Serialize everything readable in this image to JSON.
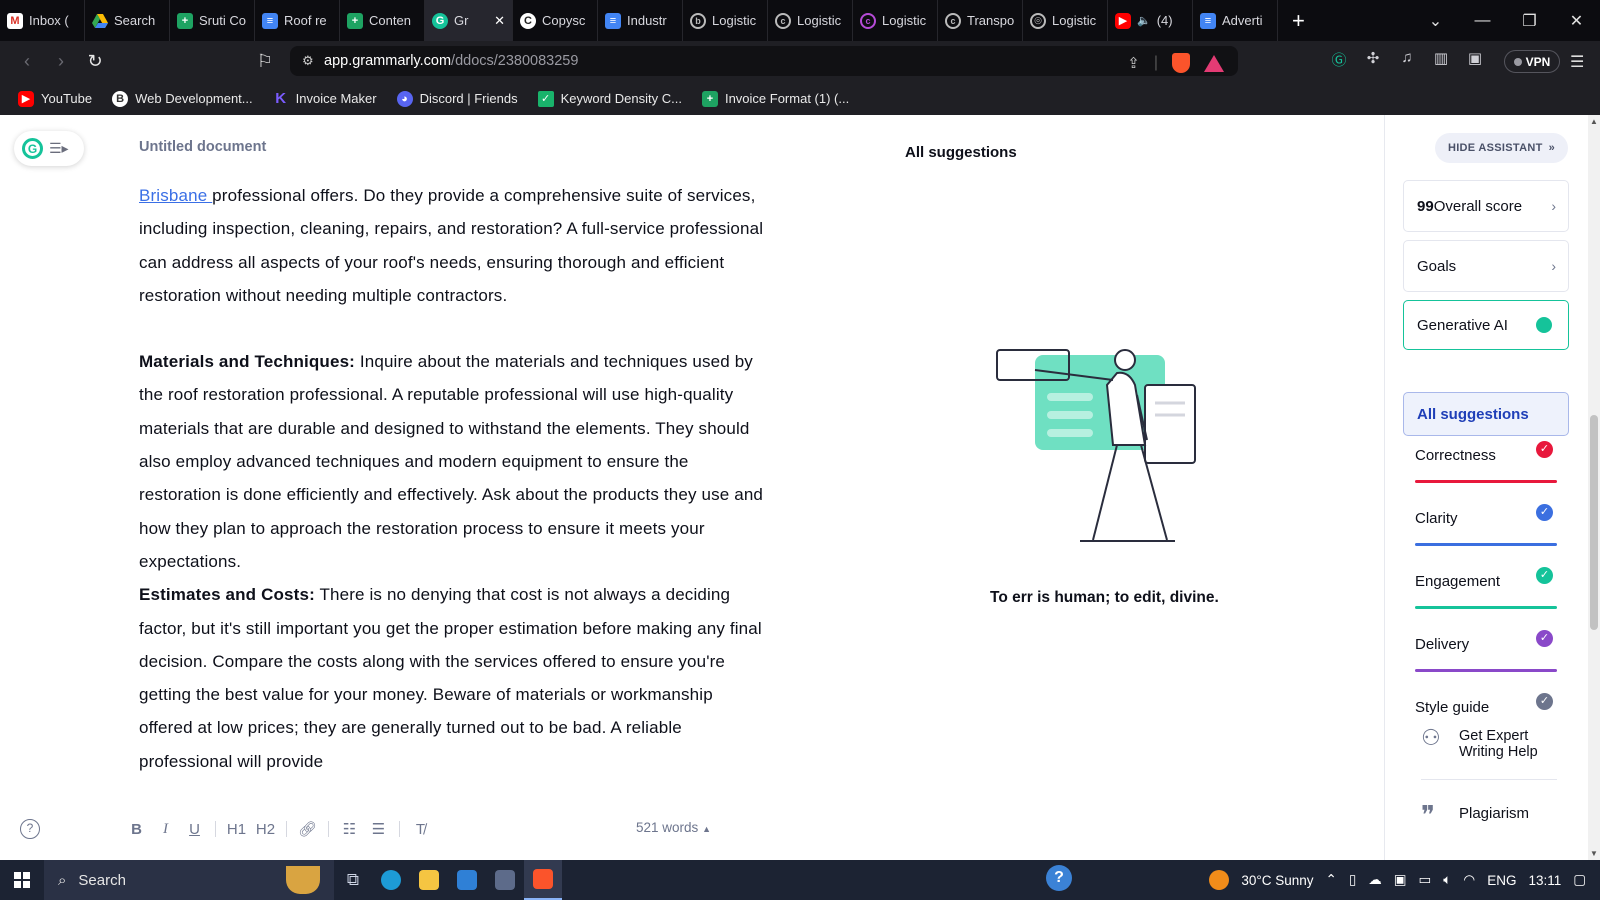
{
  "browser": {
    "tabs": [
      {
        "label": "Inbox (",
        "icon": "gmail-icon"
      },
      {
        "label": "Search",
        "icon": "google-drive-icon"
      },
      {
        "label": "Sruti Co",
        "icon": "google-sheets-icon"
      },
      {
        "label": "Roof re",
        "icon": "google-docs-icon"
      },
      {
        "label": "Conten",
        "icon": "google-sheets-icon"
      },
      {
        "label": "Gr",
        "icon": "grammarly-icon",
        "active": true
      },
      {
        "label": "Copysc",
        "icon": "copyscape-icon"
      },
      {
        "label": "Industr",
        "icon": "google-docs-icon"
      },
      {
        "label": "Logistic",
        "icon": "site-icon"
      },
      {
        "label": "Logistic",
        "icon": "site-icon"
      },
      {
        "label": "Logistic",
        "icon": "site-icon"
      },
      {
        "label": "Transpo",
        "icon": "site-icon"
      },
      {
        "label": "Logistic",
        "icon": "site-icon"
      },
      {
        "label": "(4)",
        "icon": "youtube-icon"
      },
      {
        "label": "Adverti",
        "icon": "google-docs-icon"
      }
    ],
    "url_host": "app.grammarly.com",
    "url_path": "/ddocs/2380083259",
    "vpn_label": "VPN",
    "bookmarks": [
      {
        "label": "YouTube",
        "icon": "youtube-icon"
      },
      {
        "label": "Web Development...",
        "icon": "web-dev-icon"
      },
      {
        "label": "Invoice Maker",
        "icon": "invoice-maker-icon"
      },
      {
        "label": "Discord | Friends",
        "icon": "discord-icon"
      },
      {
        "label": "Keyword Density C...",
        "icon": "keyword-density-icon"
      },
      {
        "label": "Invoice Format (1) (...",
        "icon": "google-sheets-icon"
      }
    ]
  },
  "editor": {
    "doc_title": "Untitled document",
    "link_word": "Brisbane ",
    "para1_rest": "professional offers. Do they provide a comprehensive suite of services, including inspection, cleaning, repairs, and restoration? A full-service professional can address all aspects of your roof's needs, ensuring thorough and efficient restoration without needing multiple contractors.",
    "para2_heading": "Materials and Techniques:",
    "para2_body": " Inquire about the materials and techniques used by the roof restoration professional. A reputable professional will use high-quality materials that are durable and designed to withstand the elements. They should also employ advanced techniques and modern equipment to ensure the restoration is done efficiently and effectively. Ask about the products they use and how they plan to approach the restoration process to ensure it meets your expectations.",
    "para3_heading": "Estimates and Costs:",
    "para3_body": " There is no denying that cost is not always a deciding factor, but it's still important you get the proper estimation before making any final decision. Compare the costs along with the services offered to ensure you're getting the best value for your money. Beware of materials or workmanship offered at low prices; they are generally turned out to be bad. A reliable professional will provide",
    "word_count": "521 words",
    "toolbar": {
      "bold": "B",
      "italic": "I",
      "underline": "U",
      "h1": "H1",
      "h2": "H2"
    }
  },
  "suggestions": {
    "heading": "All suggestions",
    "empty_quote": "To err is human; to edit, divine."
  },
  "assistant": {
    "hide_label": "HIDE ASSISTANT",
    "score_value": "99",
    "score_label": " Overall score",
    "goals_label": "Goals",
    "gen_ai_label": "Generative AI",
    "all_suggestions_label": "All suggestions",
    "categories": [
      {
        "label": "Correctness",
        "color": "#e8183c"
      },
      {
        "label": "Clarity",
        "color": "#3b6fe0"
      },
      {
        "label": "Engagement",
        "color": "#15c39a"
      },
      {
        "label": "Delivery",
        "color": "#8a49c9"
      },
      {
        "label": "Style guide",
        "color": "#6d758d"
      }
    ],
    "expert_label": "Get Expert Writing Help",
    "plagiarism_label": "Plagiarism"
  },
  "taskbar": {
    "search_label": "Search",
    "weather": "30°C  Sunny",
    "language": "ENG",
    "time": "13:11"
  }
}
